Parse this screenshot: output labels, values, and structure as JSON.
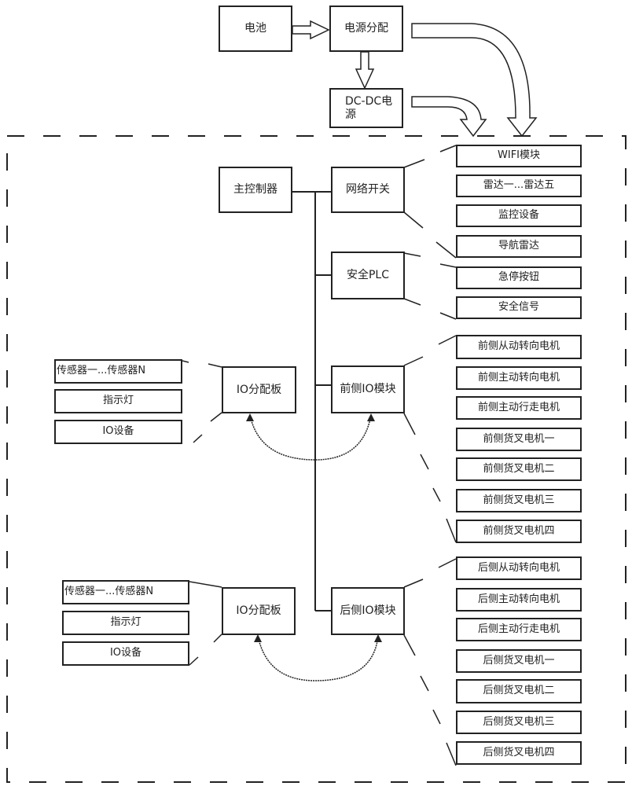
{
  "diagram": {
    "type": "system-block-diagram",
    "power": {
      "battery": "电池",
      "power_distribution": "电源分配",
      "dcdc": "DC-DC电源"
    },
    "controller": {
      "main": "主控制器",
      "network_switch": "网络开关",
      "safety_plc": "安全PLC",
      "front_io": "前侧IO模块",
      "rear_io": "后侧IO模块"
    },
    "network_devices": [
      "WIFI模块",
      "雷达一...雷达五",
      "监控设备",
      "导航雷达"
    ],
    "safety_devices": [
      "急停按钮",
      "安全信号"
    ],
    "front_motors": [
      "前侧从动转向电机",
      "前侧主动转向电机",
      "前侧主动行走电机",
      "前侧货叉电机一",
      "前侧货叉电机二",
      "前侧货叉电机三",
      "前侧货叉电机四"
    ],
    "rear_motors": [
      "后侧从动转向电机",
      "后侧主动转向电机",
      "后侧主动行走电机",
      "后侧货叉电机一",
      "后侧货叉电机二",
      "后侧货叉电机三",
      "后侧货叉电机四"
    ],
    "front_io_board": {
      "label": "IO分配板",
      "devices": [
        "传感器一...传感器N",
        "指示灯",
        "IO设备"
      ]
    },
    "rear_io_board": {
      "label": "IO分配板",
      "devices": [
        "传感器一...传感器N",
        "指示灯",
        "IO设备"
      ]
    }
  }
}
